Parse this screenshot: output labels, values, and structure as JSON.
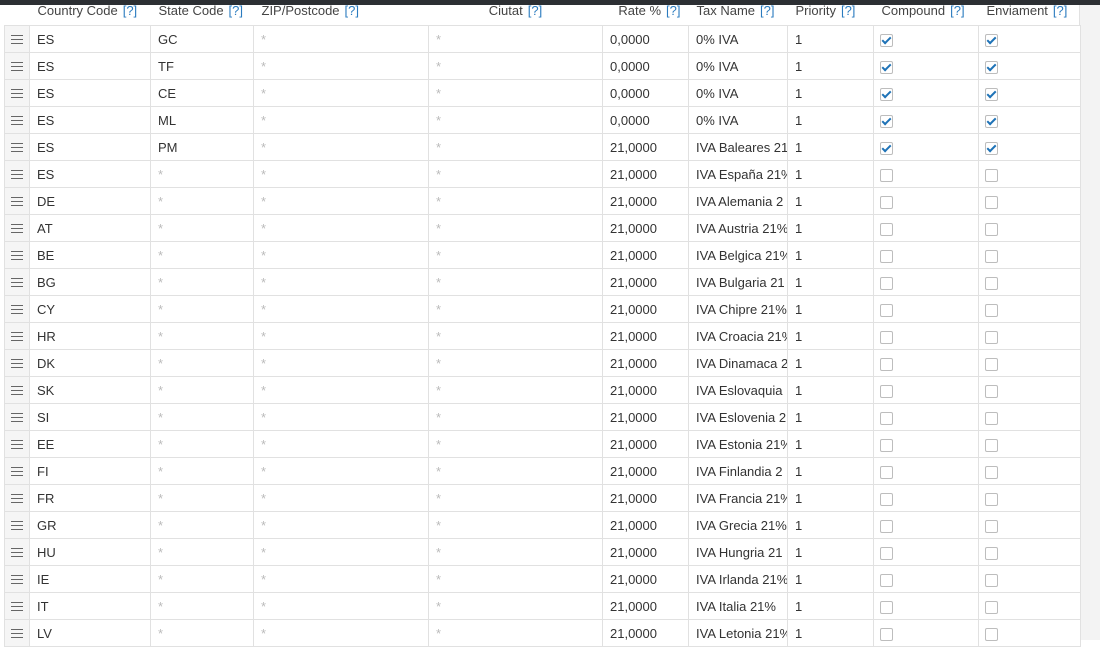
{
  "headers": {
    "country_code": "Country Code",
    "state_code": "State Code",
    "zip": "ZIP/Postcode",
    "city": "Ciutat",
    "rate": "Rate %",
    "tax_name": "Tax Name",
    "priority": "Priority",
    "compound": "Compound",
    "shipping": "Enviament",
    "help": "[?]"
  },
  "rows": [
    {
      "country": "ES",
      "state": "GC",
      "zip": "*",
      "city": "*",
      "rate": "0,0000",
      "name": "0% IVA",
      "priority": "1",
      "compound": true,
      "shipping": true
    },
    {
      "country": "ES",
      "state": "TF",
      "zip": "*",
      "city": "*",
      "rate": "0,0000",
      "name": "0% IVA",
      "priority": "1",
      "compound": true,
      "shipping": true
    },
    {
      "country": "ES",
      "state": "CE",
      "zip": "*",
      "city": "*",
      "rate": "0,0000",
      "name": "0% IVA",
      "priority": "1",
      "compound": true,
      "shipping": true
    },
    {
      "country": "ES",
      "state": "ML",
      "zip": "*",
      "city": "*",
      "rate": "0,0000",
      "name": "0% IVA",
      "priority": "1",
      "compound": true,
      "shipping": true
    },
    {
      "country": "ES",
      "state": "PM",
      "zip": "*",
      "city": "*",
      "rate": "21,0000",
      "name": "IVA Baleares 21",
      "priority": "1",
      "compound": true,
      "shipping": true
    },
    {
      "country": "ES",
      "state": "*",
      "zip": "*",
      "city": "*",
      "rate": "21,0000",
      "name": "IVA España 21%",
      "priority": "1",
      "compound": false,
      "shipping": false
    },
    {
      "country": "DE",
      "state": "*",
      "zip": "*",
      "city": "*",
      "rate": "21,0000",
      "name": "IVA Alemania 2",
      "priority": "1",
      "compound": false,
      "shipping": false
    },
    {
      "country": "AT",
      "state": "*",
      "zip": "*",
      "city": "*",
      "rate": "21,0000",
      "name": "IVA Austria 21%",
      "priority": "1",
      "compound": false,
      "shipping": false
    },
    {
      "country": "BE",
      "state": "*",
      "zip": "*",
      "city": "*",
      "rate": "21,0000",
      "name": "IVA Belgica 21%",
      "priority": "1",
      "compound": false,
      "shipping": false
    },
    {
      "country": "BG",
      "state": "*",
      "zip": "*",
      "city": "*",
      "rate": "21,0000",
      "name": "IVA Bulgaria 21",
      "priority": "1",
      "compound": false,
      "shipping": false
    },
    {
      "country": "CY",
      "state": "*",
      "zip": "*",
      "city": "*",
      "rate": "21,0000",
      "name": "IVA Chipre 21%",
      "priority": "1",
      "compound": false,
      "shipping": false
    },
    {
      "country": "HR",
      "state": "*",
      "zip": "*",
      "city": "*",
      "rate": "21,0000",
      "name": "IVA Croacia 21%",
      "priority": "1",
      "compound": false,
      "shipping": false
    },
    {
      "country": "DK",
      "state": "*",
      "zip": "*",
      "city": "*",
      "rate": "21,0000",
      "name": "IVA Dinamaca 2",
      "priority": "1",
      "compound": false,
      "shipping": false
    },
    {
      "country": "SK",
      "state": "*",
      "zip": "*",
      "city": "*",
      "rate": "21,0000",
      "name": "IVA Eslovaquia",
      "priority": "1",
      "compound": false,
      "shipping": false
    },
    {
      "country": "SI",
      "state": "*",
      "zip": "*",
      "city": "*",
      "rate": "21,0000",
      "name": "IVA Eslovenia 2",
      "priority": "1",
      "compound": false,
      "shipping": false
    },
    {
      "country": "EE",
      "state": "*",
      "zip": "*",
      "city": "*",
      "rate": "21,0000",
      "name": "IVA Estonia 21%",
      "priority": "1",
      "compound": false,
      "shipping": false
    },
    {
      "country": "FI",
      "state": "*",
      "zip": "*",
      "city": "*",
      "rate": "21,0000",
      "name": "IVA Finlandia 2",
      "priority": "1",
      "compound": false,
      "shipping": false
    },
    {
      "country": "FR",
      "state": "*",
      "zip": "*",
      "city": "*",
      "rate": "21,0000",
      "name": "IVA Francia 21%",
      "priority": "1",
      "compound": false,
      "shipping": false
    },
    {
      "country": "GR",
      "state": "*",
      "zip": "*",
      "city": "*",
      "rate": "21,0000",
      "name": "IVA Grecia 21%",
      "priority": "1",
      "compound": false,
      "shipping": false
    },
    {
      "country": "HU",
      "state": "*",
      "zip": "*",
      "city": "*",
      "rate": "21,0000",
      "name": "IVA Hungria 21",
      "priority": "1",
      "compound": false,
      "shipping": false
    },
    {
      "country": "IE",
      "state": "*",
      "zip": "*",
      "city": "*",
      "rate": "21,0000",
      "name": "IVA Irlanda 21%",
      "priority": "1",
      "compound": false,
      "shipping": false
    },
    {
      "country": "IT",
      "state": "*",
      "zip": "*",
      "city": "*",
      "rate": "21,0000",
      "name": "IVA Italia 21%",
      "priority": "1",
      "compound": false,
      "shipping": false
    },
    {
      "country": "LV",
      "state": "*",
      "zip": "*",
      "city": "*",
      "rate": "21,0000",
      "name": "IVA Letonia 21%",
      "priority": "1",
      "compound": false,
      "shipping": false
    }
  ],
  "icons": {
    "handle": "drag-handle-icon",
    "check": "checkmark-icon"
  },
  "colors": {
    "help_link": "#2a7bbf",
    "check": "#1f73b7",
    "topbar": "#2c2f33"
  }
}
